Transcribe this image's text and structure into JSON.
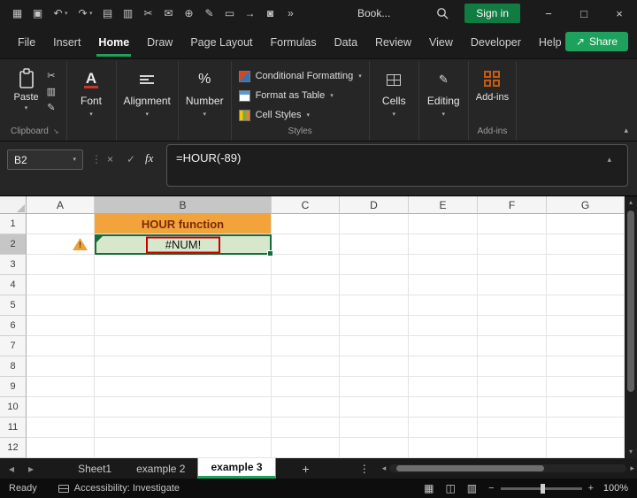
{
  "colors": {
    "excel_green": "#107C41",
    "share_green": "#1EA15C",
    "b1_bg": "#F2A33C",
    "b1_text": "#7B2D00",
    "b2_bg": "#D7E7CC",
    "error_red": "#C80000",
    "warning_orange": "#E9A23B",
    "addins_orange": "#C55A11"
  },
  "icons": {
    "app_launcher": "▦",
    "save": "▣",
    "undo": "↶",
    "redo": "↷",
    "paste_small": "▤",
    "copy": "▥",
    "cut": "✂",
    "mail": "✉",
    "insert_object": "⊕",
    "draw_pen": "✎",
    "book": "▭",
    "arrow_right": "→",
    "camera": "◙",
    "more": "»",
    "share": "↗",
    "minimize": "−",
    "maximize": "□",
    "close": "×",
    "chevron_down": "▾",
    "chevron_up": "▴",
    "chevron_left": "◂",
    "chevron_right": "▸",
    "dots_vertical": "⋮",
    "cancel": "×",
    "check": "✓",
    "fx": "fx",
    "percent": "%",
    "font_a": "A",
    "pencil": "✎",
    "brush": "✎",
    "exclamation": "!",
    "plus": "+",
    "minus": "−",
    "view_normal": "▦",
    "view_layout": "◫",
    "view_break": "▥"
  },
  "titlebar": {
    "workbook_name": "Book...",
    "sign_in_label": "Sign in"
  },
  "menu": {
    "tabs": [
      {
        "label": "File"
      },
      {
        "label": "Insert"
      },
      {
        "label": "Home"
      },
      {
        "label": "Draw"
      },
      {
        "label": "Page Layout"
      },
      {
        "label": "Formulas"
      },
      {
        "label": "Data"
      },
      {
        "label": "Review"
      },
      {
        "label": "View"
      },
      {
        "label": "Developer"
      },
      {
        "label": "Help"
      }
    ],
    "active_tab": "Home",
    "share_label": "Share"
  },
  "ribbon": {
    "paste_label": "Paste",
    "clipboard_group_label": "Clipboard",
    "font_label": "Font",
    "alignment_label": "Alignment",
    "number_label": "Number",
    "styles_items": [
      {
        "label": "Conditional Formatting"
      },
      {
        "label": "Format as Table"
      },
      {
        "label": "Cell Styles"
      }
    ],
    "styles_group_label": "Styles",
    "cells_label": "Cells",
    "editing_label": "Editing",
    "addins_label": "Add-ins",
    "addins_group_label": "Add-ins"
  },
  "formula_bar": {
    "name_box_value": "B2",
    "formula": "=HOUR(-89)"
  },
  "grid": {
    "columns": [
      "A",
      "B",
      "C",
      "D",
      "E",
      "F",
      "G"
    ],
    "rows": [
      "1",
      "2",
      "3",
      "4",
      "5",
      "6",
      "7",
      "8",
      "9",
      "10",
      "11",
      "12"
    ],
    "cells": {
      "B1": "HOUR function",
      "B2": "#NUM!"
    },
    "active_cell": "B2",
    "selected_column": "B",
    "selected_row": "2"
  },
  "sheet_tabs": {
    "tabs": [
      {
        "label": "Sheet1"
      },
      {
        "label": "example 2"
      },
      {
        "label": "example 3"
      }
    ],
    "active_tab": "example 3"
  },
  "status_bar": {
    "ready_label": "Ready",
    "accessibility_label": "Accessibility: Investigate",
    "zoom_level": "100%"
  }
}
